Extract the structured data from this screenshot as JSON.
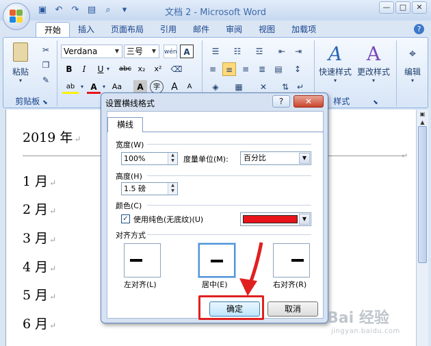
{
  "window": {
    "title": "文档 2 - Microsoft Word",
    "min": "—",
    "max": "□",
    "close": "✕"
  },
  "tabs": [
    "开始",
    "插入",
    "页面布局",
    "引用",
    "邮件",
    "审阅",
    "视图",
    "加载项"
  ],
  "ribbon": {
    "clipboard": {
      "paste": "粘贴",
      "group": "剪贴板"
    },
    "font": {
      "name": "Verdana",
      "size": "三号",
      "phonetic": "wén",
      "box": "A",
      "bold": "B",
      "italic": "I",
      "underline": "U",
      "strike": "abc",
      "sub": "x₂",
      "sup": "x²",
      "highlight": "ab",
      "fontcolor": "A",
      "case": "Aa",
      "shade": "A",
      "circle": "字",
      "grow": "A",
      "shrink": "A"
    },
    "styles": {
      "quick": "快速样式",
      "change": "更改样式",
      "group": "样式"
    },
    "edit": {
      "label": "编辑"
    }
  },
  "document": {
    "lines": [
      "2019 年",
      "1 月",
      "2 月",
      "3 月",
      "4 月",
      "5 月",
      "6 月"
    ],
    "para_mark": "↵"
  },
  "dialog": {
    "title": "设置横线格式",
    "help": "?",
    "tab": "横线",
    "width": {
      "label": "宽度(W)",
      "value": "100%",
      "unit_label": "度量单位(M):",
      "unit_value": "百分比"
    },
    "height": {
      "label": "高度(H)",
      "value": "1.5 磅"
    },
    "color": {
      "label": "颜色(C)",
      "solid_label": "使用纯色(无底纹)(U)",
      "solid_checked": true,
      "swatch": "#e8141b"
    },
    "align": {
      "label": "对齐方式",
      "left": "左对齐(L)",
      "center": "居中(E)",
      "right": "右对齐(R)",
      "selected": "center"
    },
    "ok": "确定",
    "cancel": "取消"
  },
  "watermark": {
    "text": "Bai 经验",
    "sub": "jingyan.baidu.com"
  }
}
